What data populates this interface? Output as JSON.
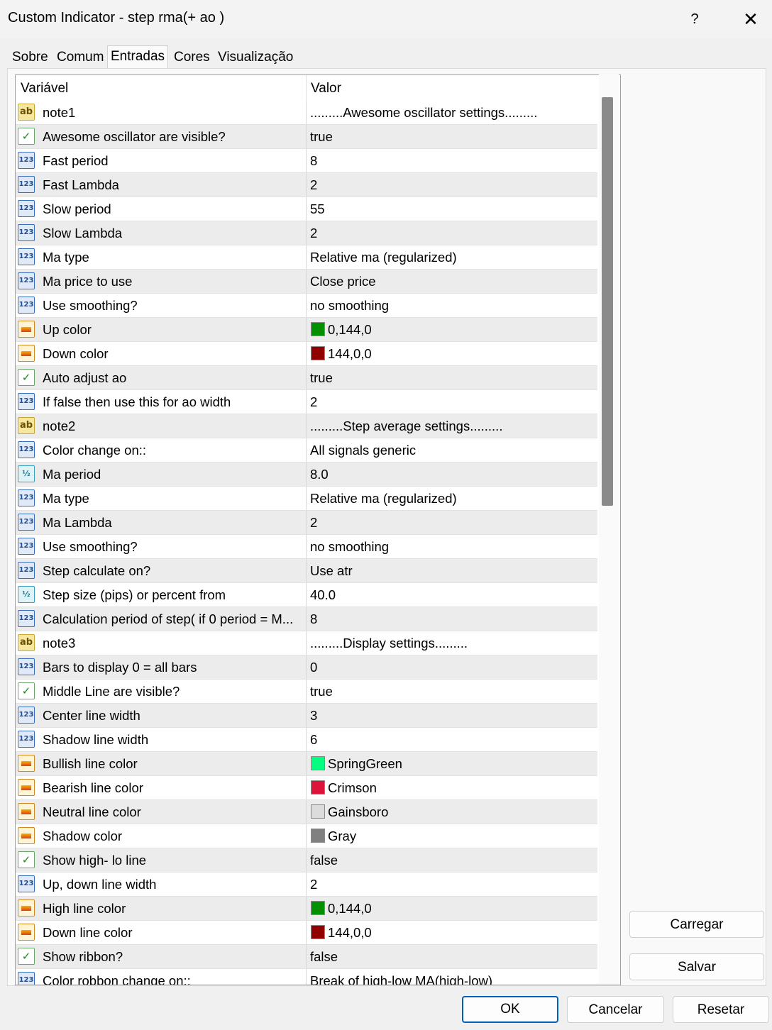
{
  "window": {
    "title": "Custom Indicator - step rma(+ ao )",
    "help": "?",
    "close": "✕"
  },
  "tabs": [
    "Sobre",
    "Comum",
    "Entradas",
    "Cores",
    "Visualização"
  ],
  "active_tab": "Entradas",
  "grid": {
    "headers": {
      "variable": "Variável",
      "value": "Valor"
    },
    "rows": [
      {
        "type": "ab",
        "name": "note1",
        "value": ".........Awesome oscillator settings........."
      },
      {
        "type": "bool",
        "name": "Awesome oscillator are visible?",
        "value": "true"
      },
      {
        "type": "int",
        "name": "Fast period",
        "value": "8"
      },
      {
        "type": "int",
        "name": "Fast Lambda",
        "value": "2"
      },
      {
        "type": "int",
        "name": "Slow period",
        "value": "55"
      },
      {
        "type": "int",
        "name": "Slow Lambda",
        "value": "2"
      },
      {
        "type": "int",
        "name": "Ma type",
        "value": "Relative ma (regularized)"
      },
      {
        "type": "int",
        "name": "Ma price to use",
        "value": "Close price"
      },
      {
        "type": "int",
        "name": "Use smoothing?",
        "value": "no smoothing"
      },
      {
        "type": "color",
        "name": "Up color",
        "value": "0,144,0",
        "swatch": "#009000"
      },
      {
        "type": "color",
        "name": "Down color",
        "value": "144,0,0",
        "swatch": "#900000"
      },
      {
        "type": "bool",
        "name": "Auto adjust ao",
        "value": "true"
      },
      {
        "type": "int",
        "name": "If  false then use this for ao width",
        "value": "2"
      },
      {
        "type": "ab",
        "name": "note2",
        "value": ".........Step average settings........."
      },
      {
        "type": "int",
        "name": "Color change on::",
        "value": "All signals generic"
      },
      {
        "type": "dbl",
        "name": "Ma period",
        "value": "8.0"
      },
      {
        "type": "int",
        "name": "Ma  type",
        "value": "Relative ma (regularized)"
      },
      {
        "type": "int",
        "name": "Ma Lambda",
        "value": "2"
      },
      {
        "type": "int",
        "name": "Use smoothing?",
        "value": "no smoothing"
      },
      {
        "type": "int",
        "name": "Step calculate on?",
        "value": "Use atr"
      },
      {
        "type": "dbl",
        "name": "Step size (pips) or percent from",
        "value": "40.0"
      },
      {
        "type": "int",
        "name": "Calculation period of step( if 0 period = M...",
        "value": "8"
      },
      {
        "type": "ab",
        "name": "note3",
        "value": ".........Display settings........."
      },
      {
        "type": "int",
        "name": "Bars to display 0 = all bars",
        "value": "0"
      },
      {
        "type": "bool",
        "name": "Middle Line are visible?",
        "value": "true"
      },
      {
        "type": "int",
        "name": "Center line  width",
        "value": "3"
      },
      {
        "type": "int",
        "name": "Shadow  line width",
        "value": "6"
      },
      {
        "type": "color",
        "name": "Bullish line  color",
        "value": "SpringGreen",
        "swatch": "#00ff7f"
      },
      {
        "type": "color",
        "name": "Bearish line  color",
        "value": "Crimson",
        "swatch": "#dc143c"
      },
      {
        "type": "color",
        "name": "Neutral line color",
        "value": "Gainsboro",
        "swatch": "#dcdcdc"
      },
      {
        "type": "color",
        "name": "Shadow  color",
        "value": "Gray",
        "swatch": "#808080"
      },
      {
        "type": "bool",
        "name": "Show high- lo  line",
        "value": "false"
      },
      {
        "type": "int",
        "name": "Up, down line  width",
        "value": "2"
      },
      {
        "type": "color",
        "name": "High line  color",
        "value": "0,144,0",
        "swatch": "#009000"
      },
      {
        "type": "color",
        "name": "Down line  color",
        "value": "144,0,0",
        "swatch": "#900000"
      },
      {
        "type": "bool",
        "name": "Show ribbon?",
        "value": "false"
      },
      {
        "type": "int",
        "name": "Color robbon change on::",
        "value": "Break of high-low MA(high-low)"
      }
    ]
  },
  "icons": {
    "ab": "ab",
    "bool": "✓",
    "int": "123",
    "dbl": "½"
  },
  "side_buttons": {
    "load": "Carregar",
    "save": "Salvar"
  },
  "footer_buttons": {
    "ok": "OK",
    "cancel": "Cancelar",
    "reset": "Resetar"
  },
  "colors": {
    "primary_border": "#005fb8"
  }
}
